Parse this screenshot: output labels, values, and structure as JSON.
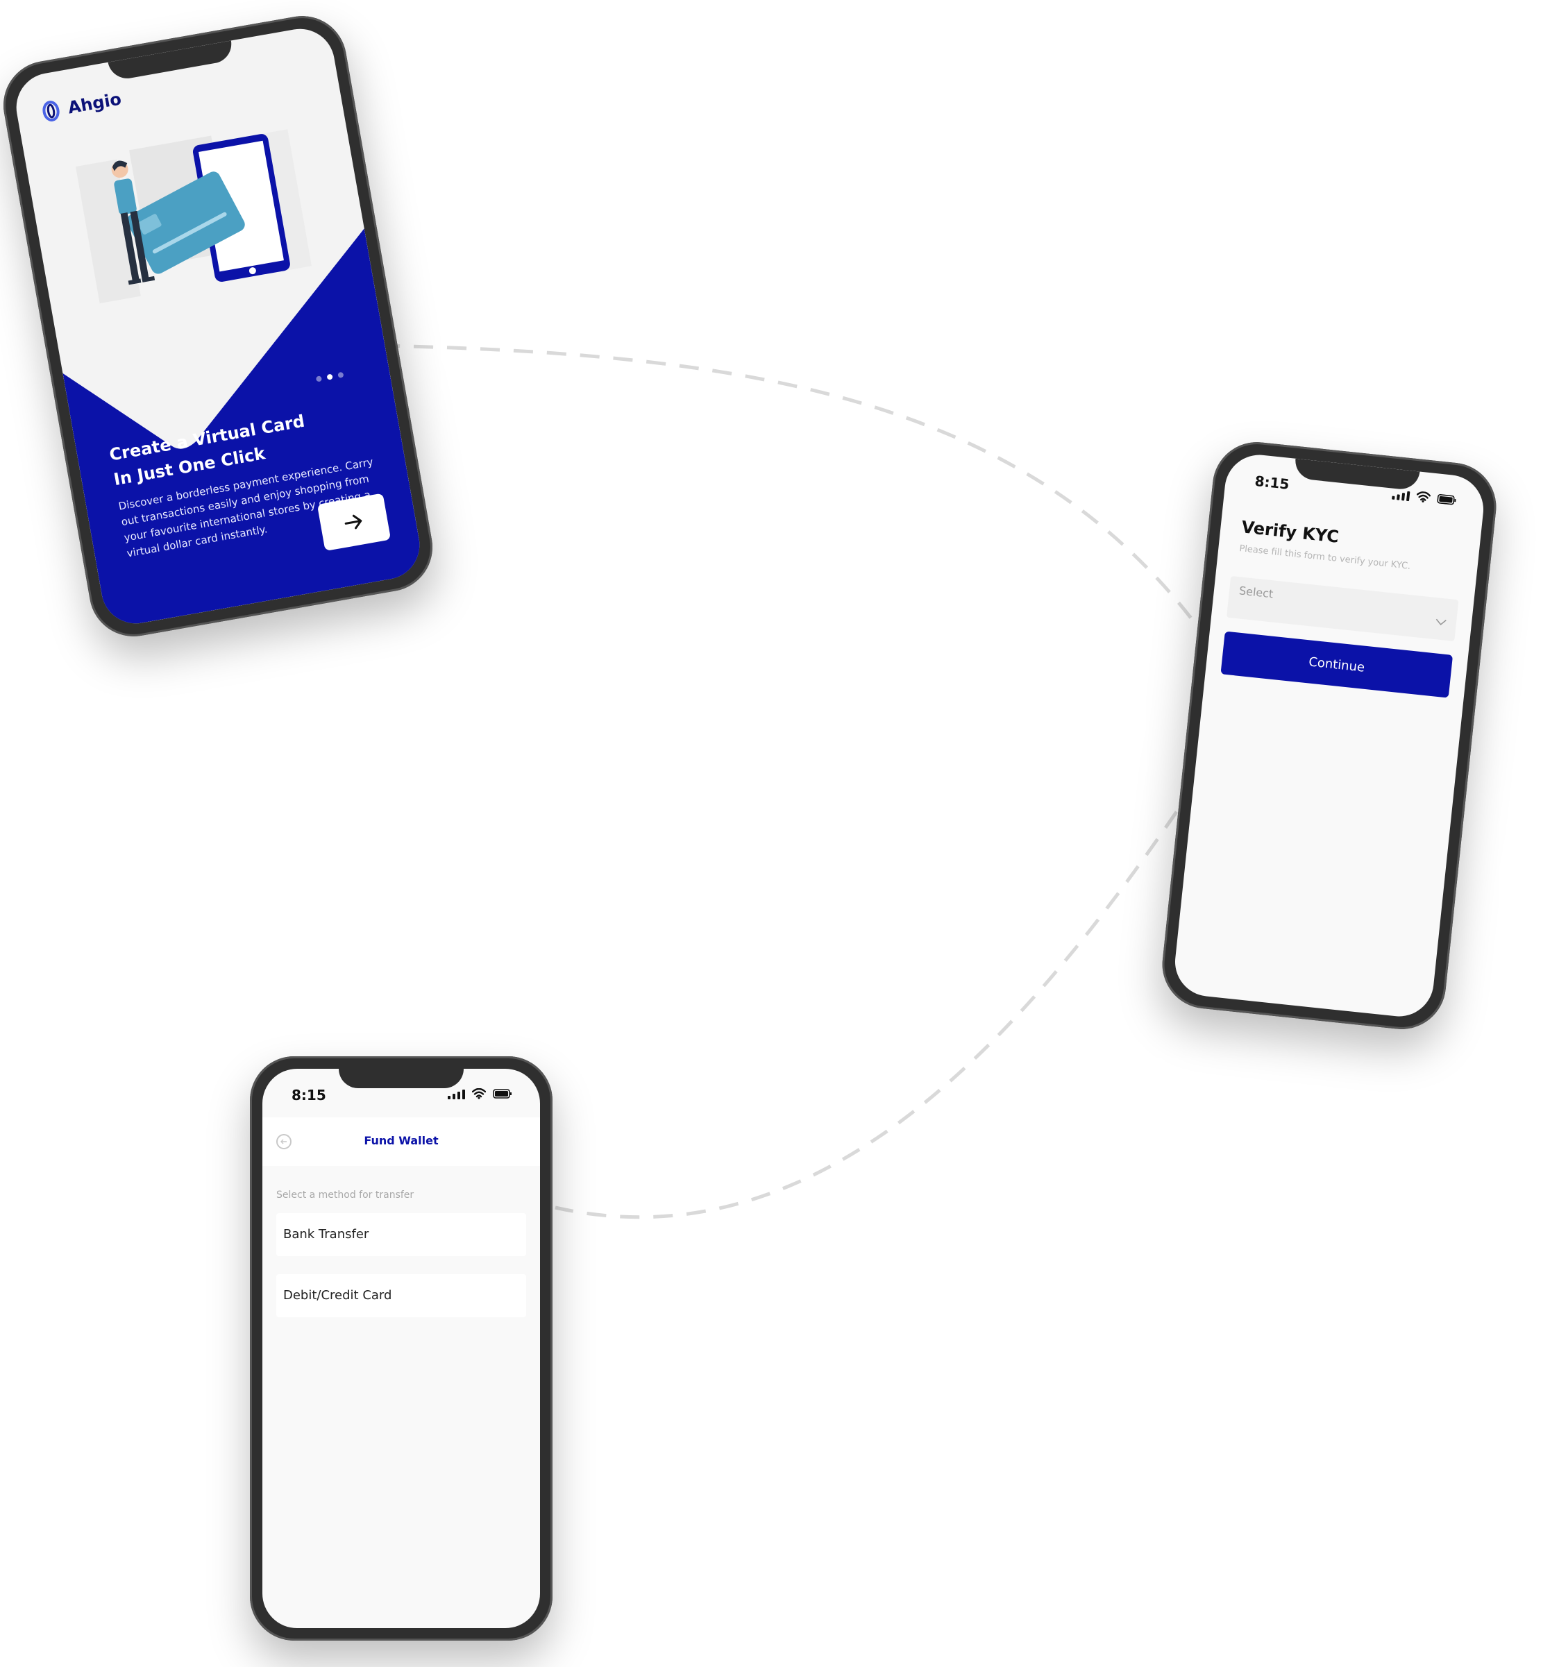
{
  "onboarding": {
    "brand": "Ahgio",
    "title_line1": "Create a Virtual Card",
    "title_line2": "In Just One Click",
    "body": "Discover a borderless payment experience. Carry out transactions easily and enjoy shopping from your favourite international stores by creating a virtual dollar card instantly.",
    "carousel": {
      "total": 3,
      "active_index": 1
    },
    "next_icon": "arrow-right-icon"
  },
  "kyc": {
    "time": "8:15",
    "title": "Verify KYC",
    "subtitle": "Please fill this form to verify your KYC.",
    "select_label": "Select",
    "button_label": "Continue"
  },
  "fund_wallet": {
    "time": "8:15",
    "title": "Fund Wallet",
    "hint": "Select a method for transfer",
    "options": [
      "Bank Transfer",
      "Debit/Credit Card"
    ]
  },
  "colors": {
    "brand_blue": "#0b12a8",
    "phone_frame": "#2f2f2f",
    "connector": "#d9d9d9"
  }
}
